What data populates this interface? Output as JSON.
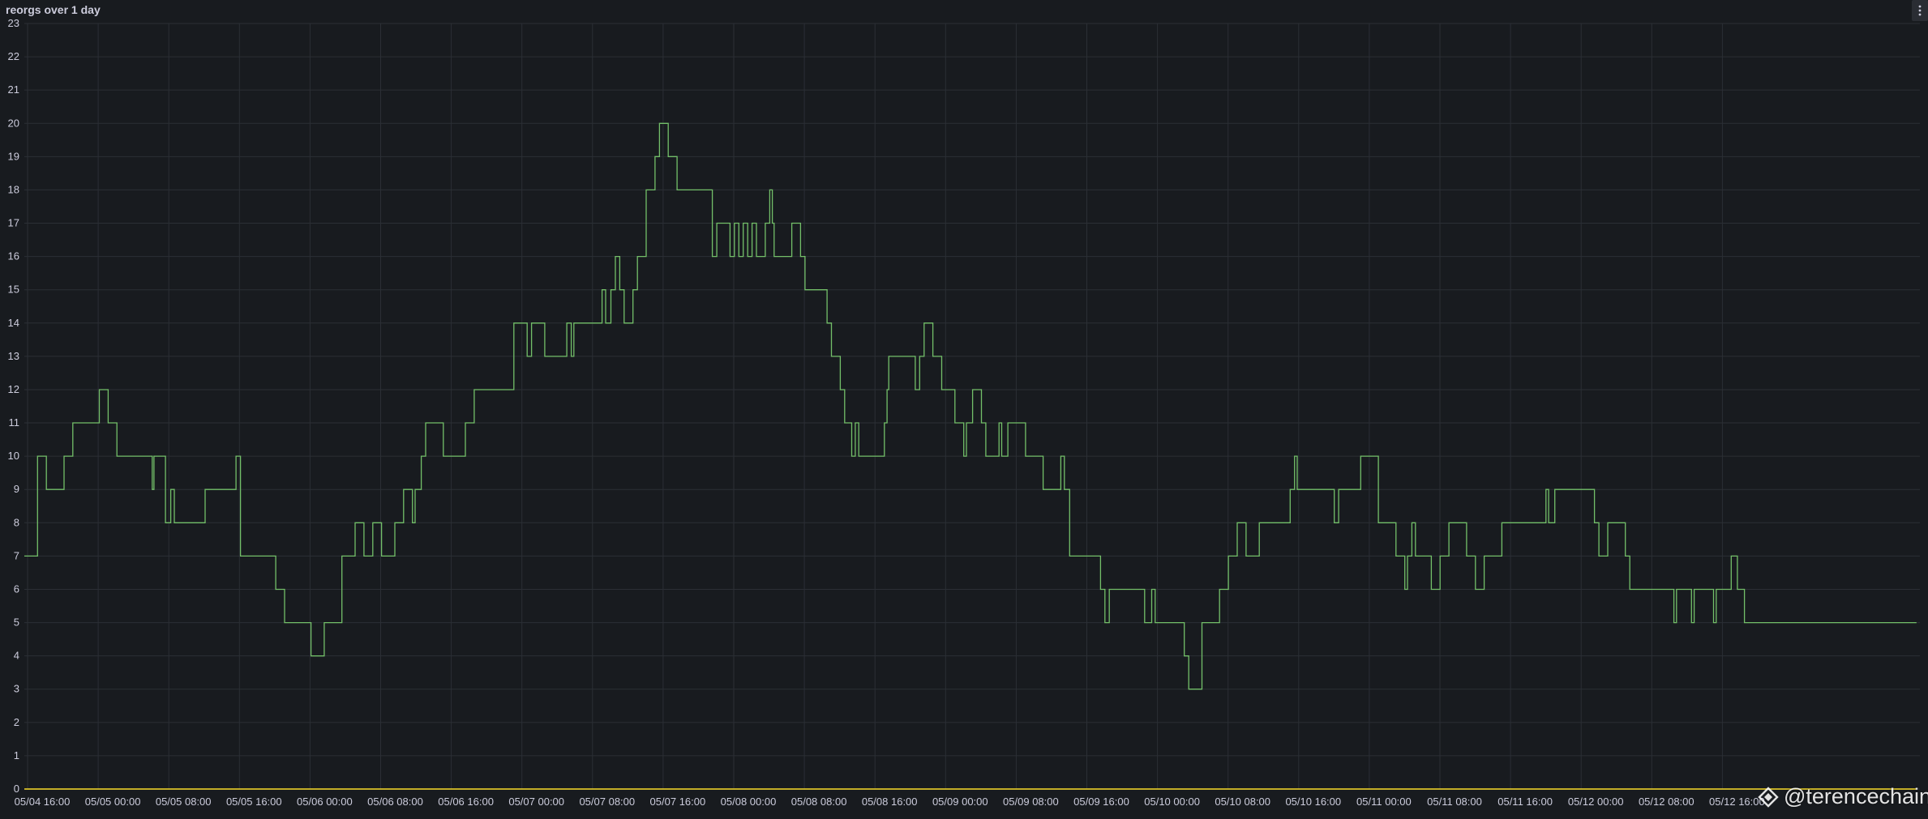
{
  "panel": {
    "title": "reorgs over 1 day"
  },
  "watermark": {
    "text": "@terencechain",
    "icon": "diamond-logo-icon"
  },
  "colors": {
    "background": "#181b1f",
    "grid": "#2b2f35",
    "series": "#73bf69",
    "baseline_series": "#fade2a",
    "text": "#ccccdc"
  },
  "chart_data": {
    "type": "line",
    "title": "reorgs over 1 day",
    "xlabel": "",
    "ylabel": "",
    "x_ticks": [
      "05/04 16:00",
      "05/05 00:00",
      "05/05 08:00",
      "05/05 16:00",
      "05/06 00:00",
      "05/06 08:00",
      "05/06 16:00",
      "05/07 00:00",
      "05/07 08:00",
      "05/07 16:00",
      "05/08 00:00",
      "05/08 08:00",
      "05/08 16:00",
      "05/09 00:00",
      "05/09 08:00",
      "05/09 16:00",
      "05/10 00:00",
      "05/10 08:00",
      "05/10 16:00",
      "05/11 00:00",
      "05/11 08:00",
      "05/11 16:00",
      "05/12 00:00",
      "05/12 08:00",
      "05/12 16:00"
    ],
    "y_ticks": [
      0,
      1,
      2,
      3,
      4,
      5,
      6,
      7,
      8,
      9,
      10,
      11,
      12,
      13,
      14,
      15,
      16,
      17,
      18,
      19,
      20,
      21,
      22,
      23
    ],
    "ylim": [
      0,
      23
    ],
    "x_unit": "hours since 05/04 16:00",
    "xlim": [
      0,
      214.5
    ],
    "grid": true,
    "legend_placement": "bottom",
    "series": [
      {
        "color": "#73bf69",
        "step": true,
        "points": [
          [
            0.0,
            7
          ],
          [
            1.5,
            10
          ],
          [
            2.5,
            9
          ],
          [
            4.5,
            10
          ],
          [
            5.5,
            11
          ],
          [
            8.5,
            12
          ],
          [
            9.5,
            11
          ],
          [
            10.5,
            10
          ],
          [
            14.5,
            9
          ],
          [
            14.7,
            10
          ],
          [
            16.0,
            8
          ],
          [
            16.6,
            9
          ],
          [
            17.0,
            8
          ],
          [
            20.5,
            9
          ],
          [
            24.0,
            10
          ],
          [
            24.5,
            7
          ],
          [
            28.5,
            6
          ],
          [
            29.5,
            5
          ],
          [
            32.5,
            4
          ],
          [
            34.0,
            5
          ],
          [
            36.0,
            7
          ],
          [
            37.5,
            8
          ],
          [
            38.5,
            7
          ],
          [
            39.5,
            8
          ],
          [
            40.5,
            7
          ],
          [
            42.0,
            8
          ],
          [
            43.0,
            9
          ],
          [
            44.0,
            8
          ],
          [
            44.3,
            9
          ],
          [
            45.0,
            10
          ],
          [
            45.5,
            11
          ],
          [
            47.5,
            10
          ],
          [
            50.0,
            11
          ],
          [
            51.0,
            12
          ],
          [
            55.5,
            14
          ],
          [
            57.0,
            13
          ],
          [
            57.5,
            14
          ],
          [
            59.0,
            13
          ],
          [
            61.5,
            14
          ],
          [
            62.0,
            13
          ],
          [
            62.3,
            14
          ],
          [
            65.5,
            15
          ],
          [
            65.9,
            14
          ],
          [
            66.5,
            15
          ],
          [
            67.0,
            16
          ],
          [
            67.5,
            15
          ],
          [
            68.0,
            14
          ],
          [
            69.0,
            15
          ],
          [
            69.5,
            16
          ],
          [
            70.5,
            18
          ],
          [
            71.5,
            19
          ],
          [
            72.0,
            20
          ],
          [
            73.0,
            19
          ],
          [
            74.0,
            18
          ],
          [
            78.0,
            16
          ],
          [
            78.5,
            17
          ],
          [
            80.0,
            16
          ],
          [
            80.5,
            17
          ],
          [
            81.0,
            16
          ],
          [
            81.5,
            17
          ],
          [
            82.0,
            16
          ],
          [
            82.5,
            17
          ],
          [
            83.0,
            16
          ],
          [
            84.0,
            17
          ],
          [
            84.5,
            18
          ],
          [
            84.8,
            17
          ],
          [
            85.0,
            16
          ],
          [
            87.0,
            17
          ],
          [
            88.0,
            16
          ],
          [
            88.5,
            15
          ],
          [
            91.0,
            14
          ],
          [
            91.5,
            13
          ],
          [
            92.5,
            12
          ],
          [
            93.0,
            11
          ],
          [
            93.8,
            10
          ],
          [
            94.2,
            11
          ],
          [
            94.6,
            10
          ],
          [
            97.5,
            11
          ],
          [
            97.8,
            12
          ],
          [
            98.0,
            13
          ],
          [
            101.0,
            12
          ],
          [
            101.5,
            13
          ],
          [
            102.0,
            14
          ],
          [
            103.0,
            13
          ],
          [
            104.0,
            12
          ],
          [
            105.5,
            11
          ],
          [
            106.5,
            10
          ],
          [
            106.8,
            11
          ],
          [
            107.5,
            12
          ],
          [
            108.5,
            11
          ],
          [
            109.0,
            10
          ],
          [
            110.5,
            11
          ],
          [
            110.8,
            10
          ],
          [
            111.5,
            11
          ],
          [
            113.5,
            10
          ],
          [
            115.5,
            9
          ],
          [
            117.5,
            10
          ],
          [
            117.9,
            9
          ],
          [
            118.5,
            7
          ],
          [
            122.0,
            6
          ],
          [
            122.5,
            5
          ],
          [
            123.0,
            6
          ],
          [
            127.0,
            5
          ],
          [
            127.8,
            6
          ],
          [
            128.2,
            5
          ],
          [
            131.5,
            4
          ],
          [
            132.0,
            3
          ],
          [
            133.5,
            5
          ],
          [
            135.5,
            6
          ],
          [
            136.5,
            7
          ],
          [
            137.5,
            8
          ],
          [
            138.5,
            7
          ],
          [
            140.0,
            8
          ],
          [
            143.5,
            9
          ],
          [
            144.0,
            10
          ],
          [
            144.3,
            9
          ],
          [
            148.5,
            8
          ],
          [
            149.0,
            9
          ],
          [
            151.5,
            10
          ],
          [
            153.5,
            8
          ],
          [
            155.5,
            7
          ],
          [
            156.5,
            6
          ],
          [
            156.8,
            7
          ],
          [
            157.3,
            8
          ],
          [
            157.7,
            7
          ],
          [
            159.5,
            6
          ],
          [
            160.5,
            7
          ],
          [
            161.5,
            8
          ],
          [
            163.5,
            7
          ],
          [
            164.5,
            6
          ],
          [
            165.5,
            7
          ],
          [
            167.5,
            8
          ],
          [
            172.5,
            9
          ],
          [
            172.8,
            8
          ],
          [
            173.5,
            9
          ],
          [
            178.0,
            8
          ],
          [
            178.5,
            7
          ],
          [
            179.5,
            8
          ],
          [
            181.5,
            7
          ],
          [
            182.0,
            6
          ],
          [
            187.0,
            5
          ],
          [
            187.3,
            6
          ],
          [
            189.0,
            5
          ],
          [
            189.3,
            6
          ],
          [
            191.5,
            5
          ],
          [
            191.8,
            6
          ],
          [
            193.5,
            7
          ],
          [
            194.2,
            6
          ],
          [
            195.0,
            5
          ],
          [
            214.5,
            5
          ]
        ]
      },
      {
        "color": "#fade2a",
        "step": true,
        "points": [
          [
            0.0,
            0
          ],
          [
            214.5,
            0
          ]
        ]
      }
    ]
  }
}
